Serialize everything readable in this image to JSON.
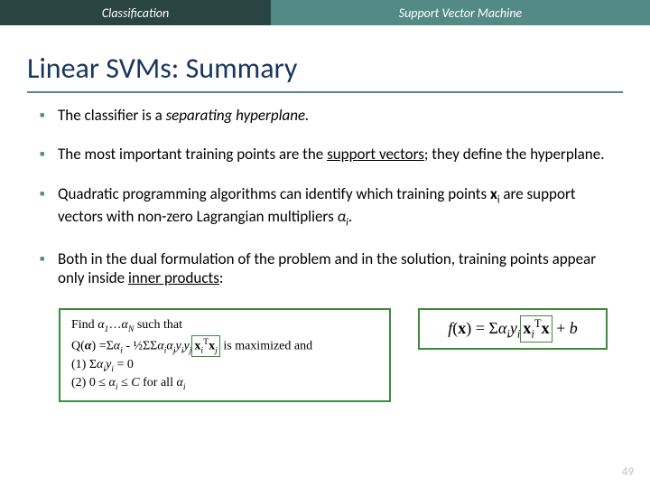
{
  "header": {
    "left": "Classification",
    "right": "Support Vector Machine"
  },
  "title": "Linear SVMs:  Summary",
  "bullets": [
    {
      "pre": "The classifier is a ",
      "em": "separating hyperplane.",
      "post": ""
    },
    {
      "html": "The most important training points are the <span class='u'>support vectors</span>; they define the hyperplane."
    },
    {
      "html": "Quadratic programming algorithms can identify which training points <span class='b'>x</span><span class='sub'>i</span> are support vectors with non-zero Lagrangian multipliers <span class='em'>α</span><span class='sub em'>i</span>."
    },
    {
      "html": "Both in the dual formulation of the problem and in the solution, training points appear only inside <span class='u'>inner products</span>:"
    }
  ],
  "box_left": {
    "l1_a": "Find ",
    "l1_b": "α",
    "l1_c": "1",
    "l1_d": "…",
    "l1_e": "α",
    "l1_f": "N",
    "l1_g": " such that",
    "l2_a": "Q(",
    "l2_b": "α",
    "l2_c": ") =Σ",
    "l2_d": "α",
    "l2_e": "i",
    "l2_f": " - ½ΣΣ",
    "l2_g": "α",
    "l2_h": "i",
    "l2_i": "α",
    "l2_j": "j",
    "l2_k": "y",
    "l2_l": "i",
    "l2_m": "y",
    "l2_n": "j",
    "l2_box_a": "x",
    "l2_box_b": "i",
    "l2_box_c": "T",
    "l2_box_d": "x",
    "l2_box_e": "j",
    "l2_o": " is maximized and",
    "l3_a": "(1)  Σ",
    "l3_b": "α",
    "l3_c": "i",
    "l3_d": "y",
    "l3_e": "i",
    "l3_f": " = 0",
    "l4_a": "(2)  0 ≤ ",
    "l4_b": "α",
    "l4_c": "i",
    "l4_d": " ≤ ",
    "l4_e": "C",
    "l4_f": " for all ",
    "l4_g": "α",
    "l4_h": "i"
  },
  "box_right": {
    "a": "f",
    "b": "(",
    "c": "x",
    "d": ") = Σ",
    "e": "α",
    "f": "i",
    "g": "y",
    "h": "i",
    "box_a": "x",
    "box_b": "i",
    "box_c": "T",
    "box_d": "x",
    "i": " + ",
    "j": "b"
  },
  "page": "49"
}
